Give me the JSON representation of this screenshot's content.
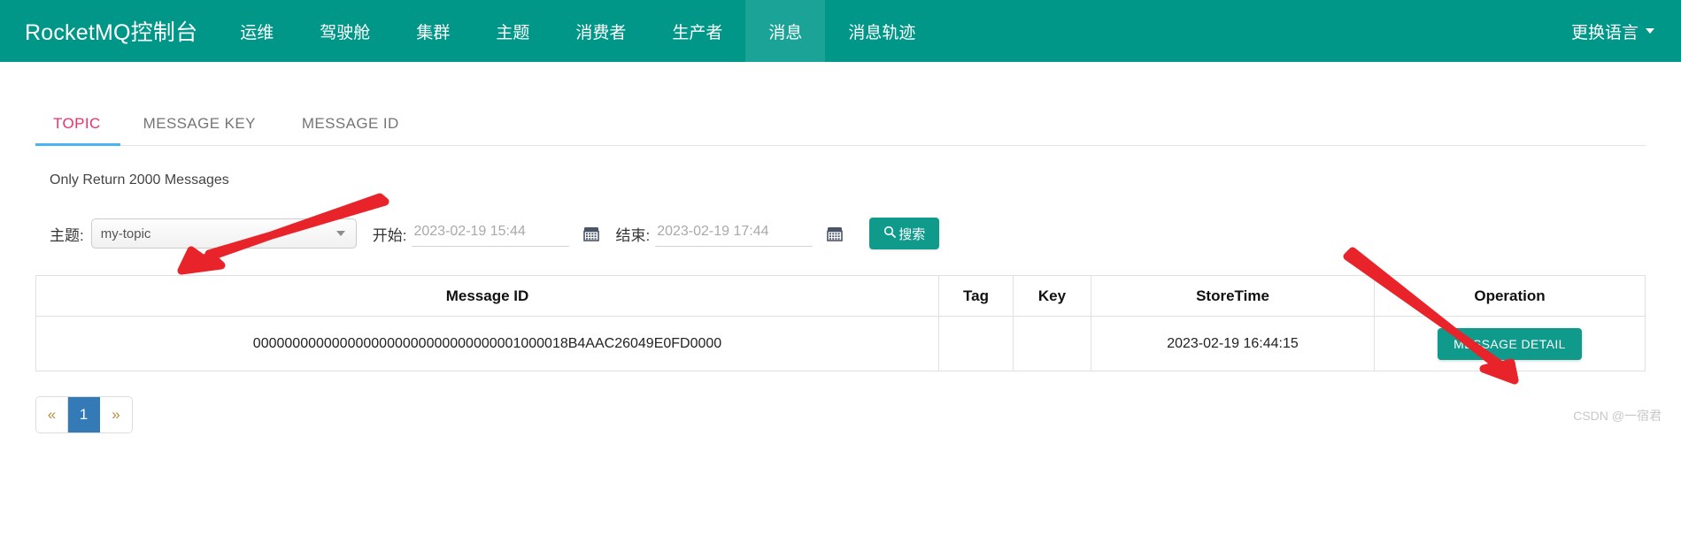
{
  "navbar": {
    "brand": "RocketMQ控制台",
    "items": [
      {
        "label": "运维",
        "active": false
      },
      {
        "label": "驾驶舱",
        "active": false
      },
      {
        "label": "集群",
        "active": false
      },
      {
        "label": "主题",
        "active": false
      },
      {
        "label": "消费者",
        "active": false
      },
      {
        "label": "生产者",
        "active": false
      },
      {
        "label": "消息",
        "active": true
      },
      {
        "label": "消息轨迹",
        "active": false
      }
    ],
    "language_label": "更换语言",
    "language_icon": "chevron-down-icon",
    "background_color": "#009688",
    "active_background_color": "#1aa396"
  },
  "tabs": [
    {
      "label": "TOPIC",
      "active": true
    },
    {
      "label": "MESSAGE KEY",
      "active": false
    },
    {
      "label": "MESSAGE ID",
      "active": false
    }
  ],
  "tab_active_color": "#ef3167",
  "tab_underline_color": "#4cb3f5",
  "notice": "Only Return 2000 Messages",
  "search_form": {
    "topic_label": "主题:",
    "topic_value": "my-topic",
    "topic_caret_icon": "chevron-down-icon",
    "begin_label": "开始:",
    "begin_value": "2023-02-19 15:44",
    "begin_placeholder": "2023-02-19 15:44",
    "begin_calendar_icon": "calendar-icon",
    "end_label": "结束:",
    "end_value": "2023-02-19 17:44",
    "end_placeholder": "2023-02-19 17:44",
    "end_calendar_icon": "calendar-icon",
    "search_button_label": "搜索",
    "search_button_icon": "search-icon",
    "search_button_color": "#0f9a8c"
  },
  "table": {
    "columns": [
      "Message ID",
      "Tag",
      "Key",
      "StoreTime",
      "Operation"
    ],
    "rows": [
      {
        "message_id": "0000000000000000000000000000000001000018B4AAC26049E0FD0000",
        "tag": "",
        "key": "",
        "store_time": "2023-02-19 16:44:15",
        "operation_label": "MESSAGE DETAIL"
      }
    ]
  },
  "pagination": {
    "prev_label": "«",
    "next_label": "»",
    "pages": [
      {
        "label": "1",
        "active": true
      }
    ],
    "active_color": "#337ab7"
  },
  "watermark": "CSDN @一宿君",
  "annotation_arrow_color": "#e8232a"
}
